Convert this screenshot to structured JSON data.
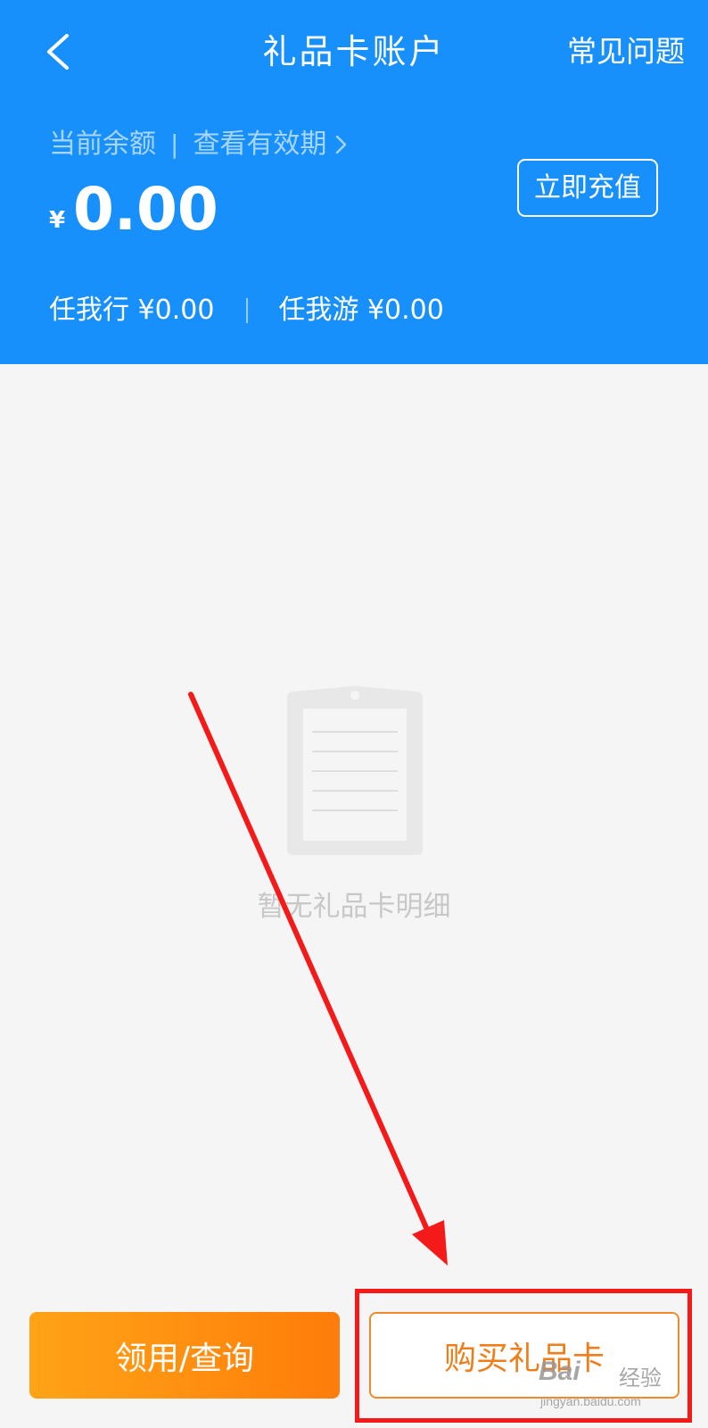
{
  "nav": {
    "back_icon": "chevron-left-icon",
    "title": "礼品卡账户",
    "faq_label": "常见问题"
  },
  "balance": {
    "label": "当前余额",
    "separator": "|",
    "validity_label": "查看有效期",
    "validity_icon": "chevron-right-icon",
    "currency": "¥",
    "amount": "0.00",
    "recharge_label": "立即充值",
    "sub_balances": [
      {
        "label": "任我行 ¥0.00"
      },
      {
        "label": "任我游 ¥0.00"
      }
    ]
  },
  "empty_state": {
    "icon": "clipboard-icon",
    "text": "暂无礼品卡明细"
  },
  "actions": {
    "claim_label": "领用/查询",
    "buy_label": "购买礼品卡"
  },
  "watermark": {
    "logo": "Bai",
    "sub": "经验",
    "url": "jingyan.baidu.com"
  },
  "colors": {
    "header_bg": "#1890fc",
    "claim_gradient_start": "#ffa417",
    "claim_gradient_end": "#ff7c0a",
    "buy_accent": "#ef7d1a",
    "annotation_red": "#f41a1a"
  }
}
